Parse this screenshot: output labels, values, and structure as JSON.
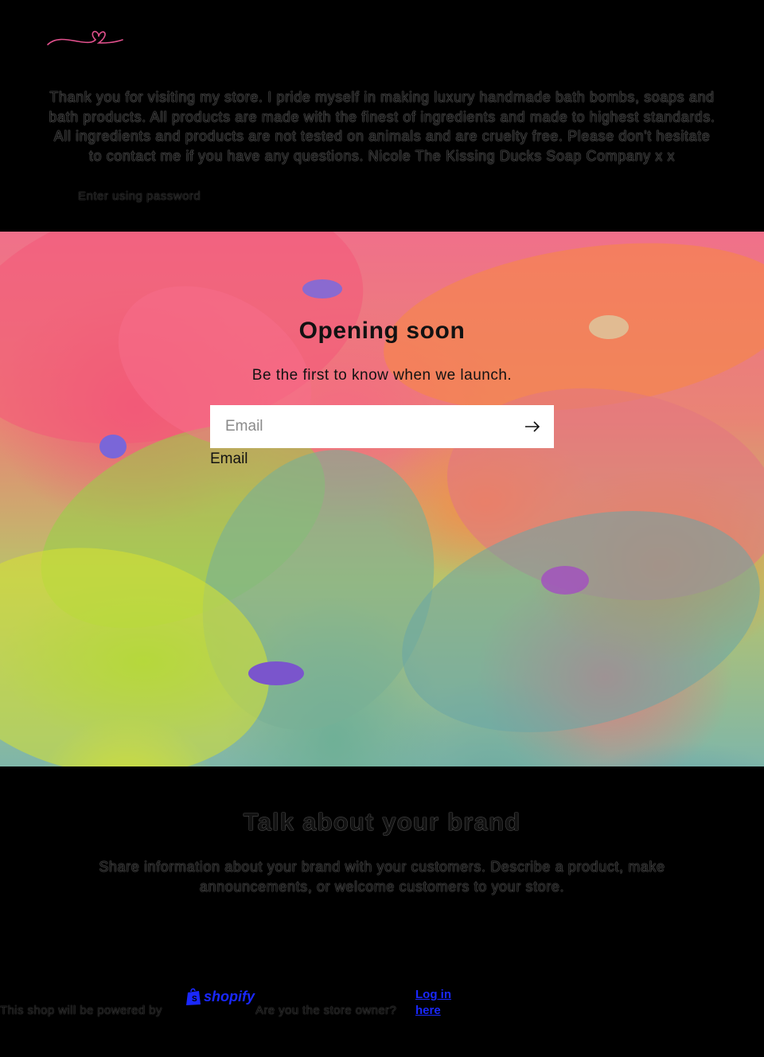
{
  "header": {
    "logo_icon": "heart-signature-logo",
    "logo_color": "#e0508c"
  },
  "intro": {
    "text": "Thank you for visiting my store. I pride myself in making luxury handmade bath bombs, soaps and bath products. All products are made with the finest of ingredients and made to highest standards. All ingredients and products are not tested on animals and are cruelty free. Please don't hesitate to contact me if you have any questions. Nicole The Kissing Ducks Soap Company x x",
    "password_link": "Enter using password"
  },
  "hero": {
    "title": "Opening soon",
    "subtitle": "Be the first to know when we launch.",
    "email_placeholder": "Email",
    "email_label": "Email",
    "submit_icon": "arrow-right-icon"
  },
  "brand": {
    "title": "Talk about your brand",
    "text": "Share information about your brand with your customers. Describe a product, make announcements, or welcome customers to your store."
  },
  "footer": {
    "powered_text": "This shop will be powered by",
    "shopify_label": "shopify",
    "owner_text": "Are you the store owner?",
    "login_label": "Log in",
    "here_label": "here",
    "link_color": "#1a28ff"
  }
}
